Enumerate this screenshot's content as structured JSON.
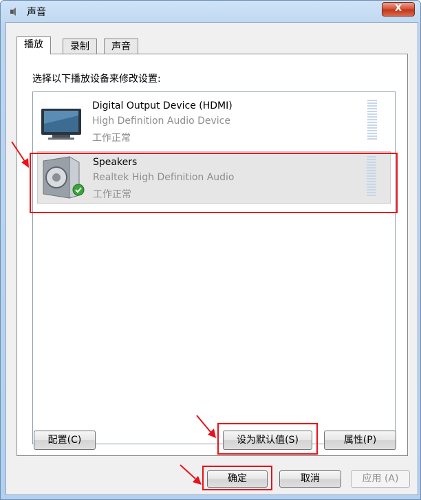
{
  "window": {
    "title": "声音",
    "close_label": "X"
  },
  "tabs": [
    {
      "label": "播放",
      "active": true
    },
    {
      "label": "录制",
      "active": false
    },
    {
      "label": "声音",
      "active": false
    }
  ],
  "instruction": "选择以下播放设备来修改设置:",
  "devices": [
    {
      "name": "Digital Output Device (HDMI)",
      "description": "High Definition Audio Device",
      "status": "工作正常",
      "icon": "monitor-icon",
      "selected": false
    },
    {
      "name": "Speakers",
      "description": "Realtek High Definition Audio",
      "status": "工作正常",
      "icon": "speaker-icon",
      "default_badge": "check-icon",
      "selected": true
    }
  ],
  "buttons": {
    "configure": "配置(C)",
    "set_default": "设为默认值(S)",
    "properties": "属性(P)",
    "ok": "确定",
    "cancel": "取消",
    "apply": "应用 (A)"
  },
  "annotation_color": "#e8121a"
}
